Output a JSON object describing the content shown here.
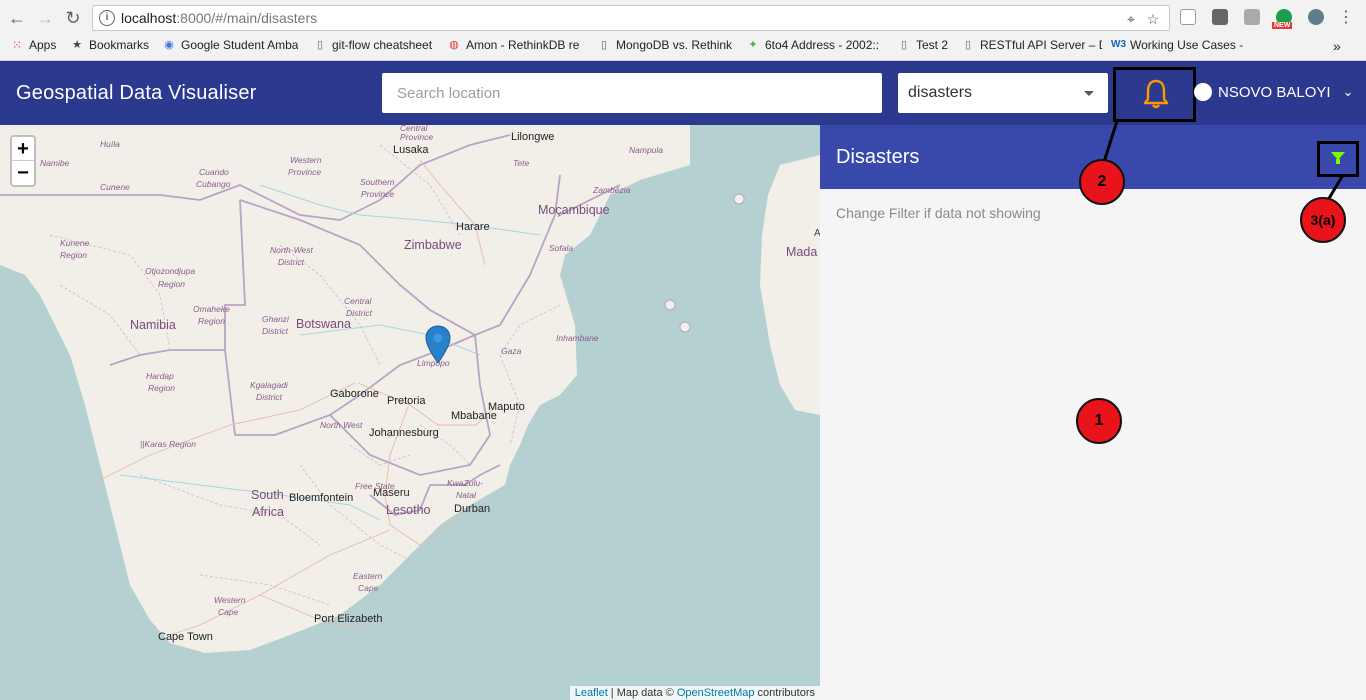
{
  "browser": {
    "url_host": "localhost",
    "url_path": ":8000/#/main/disasters",
    "bookmarks": [
      {
        "label": "Apps",
        "icon": "apps-grid-icon"
      },
      {
        "label": "Bookmarks",
        "icon": "star-icon"
      },
      {
        "label": "Google Student Amba",
        "icon": "google-icon"
      },
      {
        "label": "git-flow cheatsheet",
        "icon": "page-icon"
      },
      {
        "label": "Amon - RethinkDB re",
        "icon": "amon-icon"
      },
      {
        "label": "MongoDB vs. Rethink",
        "icon": "page-icon"
      },
      {
        "label": "6to4 Address - 2002::",
        "icon": "net-icon"
      },
      {
        "label": "Test 2",
        "icon": "page-icon"
      },
      {
        "label": "RESTful API Server – D",
        "icon": "page-icon"
      },
      {
        "label": "Working Use Cases - S",
        "icon": "w3-icon"
      }
    ],
    "overflow": "»",
    "ext_badge": "NEW"
  },
  "appbar": {
    "title": "Geospatial Data Visualiser",
    "search_placeholder": "Search location",
    "dataset_selected": "disasters",
    "user_name": "NSOVO BALOYI"
  },
  "map": {
    "zoom_in": "+",
    "zoom_out": "−",
    "attribution_leaflet": "Leaflet",
    "attribution_sep": " | Map data © ",
    "attribution_osm": "OpenStreetMap",
    "attribution_tail": " contributors",
    "labels": {
      "lusaka": "Lusaka",
      "lilongwe": "Lilongwe",
      "harare": "Harare",
      "zimbabwe": "Zimbabwe",
      "mocambique": "Moçambique",
      "namibia": "Namibia",
      "botswana": "Botswana",
      "gaborone": "Gaborone",
      "pretoria": "Pretoria",
      "johannesburg": "Johannesburg",
      "mbabane": "Mbabane",
      "maputo": "Maputo",
      "south": "South",
      "africa": "Africa",
      "bloemfontein": "Bloemfontein",
      "maseru": "Maseru",
      "lesotho": "Lesotho",
      "durban": "Durban",
      "port_elizabeth": "Port Elizabeth",
      "cape_town": "Cape Town",
      "mada": "Mada",
      "a": "A",
      "huila": "Huíla",
      "namibe": "Namibe",
      "cunene": "Cunene",
      "cuando": "Cuando",
      "cubango": "Cubango",
      "western_province_1": "Western",
      "western_province_2": "Province",
      "southern_province_1": "Southern",
      "southern_province_2": "Province",
      "province_top": "Province",
      "central_top": "Central",
      "tete": "Tete",
      "nampula": "Nampula",
      "zambezia": "Zambézia",
      "kunene_1": "Kunene",
      "kunene_2": "Region",
      "otjozondjupa_1": "Otjozondjupa",
      "otjozondjupa_2": "Region",
      "omaheke_1": "Omaheke",
      "omaheke_2": "Region",
      "northwest_1": "North-West",
      "northwest_2": "District",
      "sofala": "Sofala",
      "ghanzi_1": "Ghanzi",
      "ghanzi_2": "District",
      "central_1": "Central",
      "central_2": "District",
      "inhambane": "Inhambane",
      "gaza": "Gaza",
      "limpopo": "Limpopo",
      "hardap_1": "Hardap",
      "hardap_2": "Region",
      "kgalagadi_1": "Kgalagadi",
      "kgalagadi_2": "District",
      "north_west": "North West",
      "karas": "||Karas Region",
      "free_state_1": "Free State",
      "kwazulu_1": "KwaZulu-",
      "kwazulu_2": "Natal",
      "eastern_1": "Eastern",
      "eastern_2": "Cape",
      "western_cape_1": "Western",
      "western_cape_2": "Cape"
    }
  },
  "panel": {
    "title": "Disasters",
    "hint": "Change Filter if data not showing"
  },
  "annotations": {
    "badge_1": "1",
    "badge_2": "2",
    "badge_3": "3(a)"
  },
  "colors": {
    "appbar": "#2b3a8f",
    "panel_header": "#3949ab",
    "bell": "#ff9800",
    "filter": "#76ff03",
    "badge": "#e8131b"
  }
}
